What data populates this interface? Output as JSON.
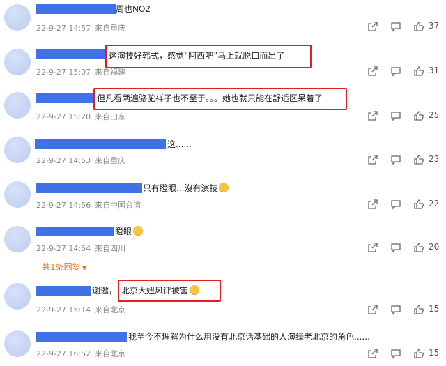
{
  "comments": [
    {
      "text": "周也NO2",
      "time": "22-9-27 14:57",
      "location": "来自重庆",
      "likes": "37"
    },
    {
      "text": "这演技好韩式，感觉“阿西吧”马上就脱口而出了",
      "time": "22-9-27 15:07",
      "location": "来自福建",
      "likes": "31"
    },
    {
      "text": "但凡看两遍骆驼祥子也不至于。。。她也就只能在舒适区呆着了",
      "time": "22-9-27 15:20",
      "location": "来自山东",
      "likes": "25"
    },
    {
      "text": "这......",
      "time": "22-9-27 14:53",
      "location": "来自重庆",
      "likes": "23"
    },
    {
      "text": "只有瞪眼...沒有演技",
      "time": "22-9-27 14:56",
      "location": "来自中国台湾",
      "likes": "22"
    },
    {
      "text": "瞪眼",
      "time": "22-9-27 14:54",
      "location": "来自四川",
      "likes": "20",
      "replies": "共1条回复"
    },
    {
      "text": "谢邀，",
      "text_hl": "北京大妞风评被害",
      "time": "22-9-27 15:14",
      "location": "来自北京",
      "likes": "15"
    },
    {
      "text": "我至今不理解为什么用没有北京话基础的人演绎老北京的角色......",
      "time": "22-9-27 16:52",
      "location": "来自北京",
      "likes": "15"
    }
  ],
  "icons": {
    "share": "share-icon",
    "comment": "comment-icon",
    "like": "thumbs-up-icon",
    "emoji": "emoji-icon",
    "chevron": "chevron-down-icon"
  },
  "colors": {
    "redaction": "#3f72e6",
    "highlight": "#e02020",
    "reply": "#e8731a"
  }
}
